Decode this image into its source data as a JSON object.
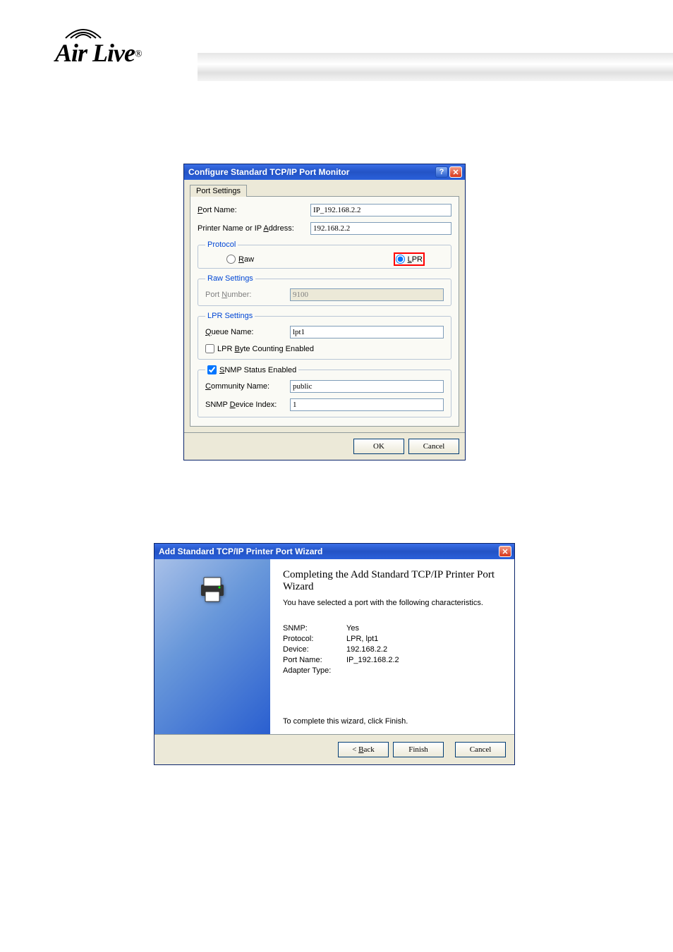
{
  "logo": {
    "text": "Air Live",
    "reg": "®"
  },
  "dialog1": {
    "title": "Configure Standard TCP/IP Port Monitor",
    "tab": "Port Settings",
    "port_name_label": "Port Name:",
    "port_name_u": "P",
    "port_name_value": "IP_192.168.2.2",
    "printer_label_pre": "Printer Name or IP ",
    "printer_label_u": "A",
    "printer_label_post": "ddress:",
    "printer_value": "192.168.2.2",
    "protocol_legend": "Protocol",
    "raw_u": "R",
    "raw_post": "aw",
    "lpr_u": "L",
    "lpr_post": "PR",
    "raw_legend": "Raw Settings",
    "portnum_pre": "Port ",
    "portnum_u": "N",
    "portnum_post": "umber:",
    "portnum_value": "9100",
    "lpr_legend": "LPR Settings",
    "queue_u": "Q",
    "queue_post": "ueue Name:",
    "queue_value": "lpt1",
    "bytecount_pre": "LPR ",
    "bytecount_u": "B",
    "bytecount_post": "yte Counting Enabled",
    "snmp_u": "S",
    "snmp_post": "NMP Status Enabled",
    "community_u": "C",
    "community_post": "ommunity Name:",
    "community_value": "public",
    "devidx_pre": "SNMP ",
    "devidx_u": "D",
    "devidx_post": "evice Index:",
    "devidx_value": "1",
    "ok": "OK",
    "cancel": "Cancel"
  },
  "dialog2": {
    "title": "Add Standard TCP/IP Printer Port Wizard",
    "heading": "Completing the Add Standard TCP/IP Printer Port Wizard",
    "subtitle": "You have selected a port with the following characteristics.",
    "rows": {
      "snmp_k": "SNMP:",
      "snmp_v": "Yes",
      "proto_k": "Protocol:",
      "proto_v": "LPR, lpt1",
      "device_k": "Device:",
      "device_v": "192.168.2.2",
      "portname_k": "Port Name:",
      "portname_v": "IP_192.168.2.2",
      "adapter_k": "Adapter Type:",
      "adapter_v": ""
    },
    "footer": "To complete this wizard, click Finish.",
    "back_pre": "< ",
    "back_u": "B",
    "back_post": "ack",
    "finish": "Finish",
    "cancel": "Cancel"
  }
}
